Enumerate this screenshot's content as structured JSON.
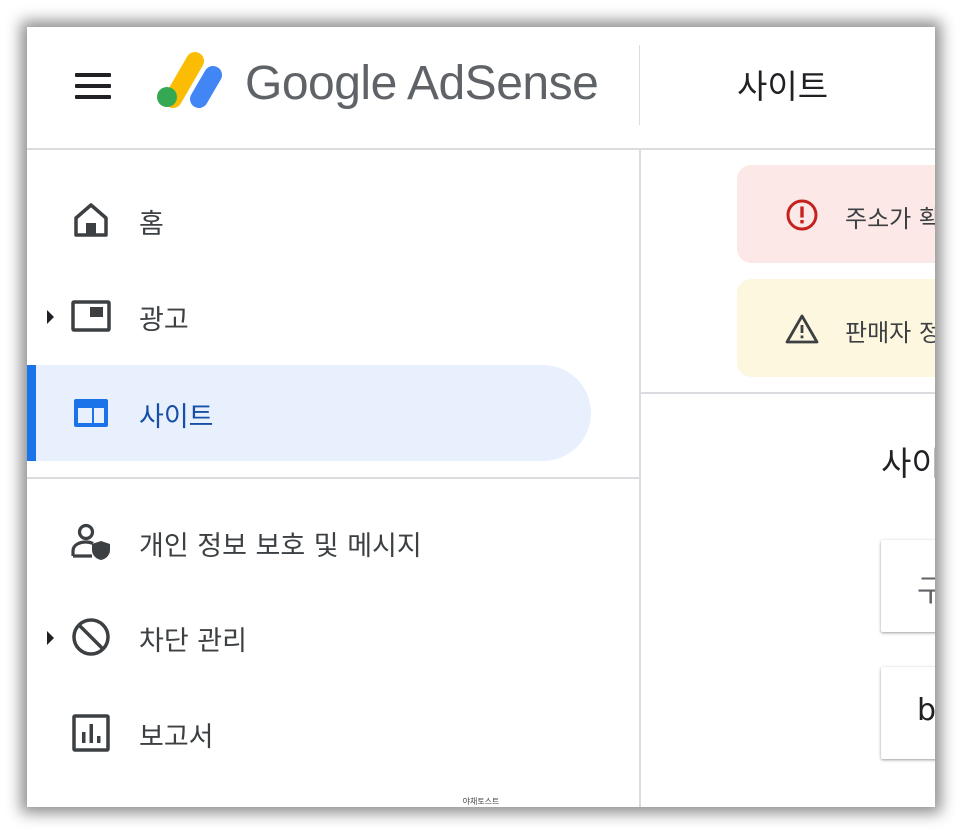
{
  "header": {
    "brand_text": "Google AdSense",
    "page_title": "사이트"
  },
  "sidebar": {
    "items": [
      {
        "label": "홈",
        "icon": "home-icon"
      },
      {
        "label": "광고",
        "icon": "ads-icon",
        "expandable": true
      },
      {
        "label": "사이트",
        "icon": "sites-icon",
        "active": true
      },
      {
        "label": "개인 정보 보호 및 메시지",
        "icon": "privacy-icon"
      },
      {
        "label": "차단 관리",
        "icon": "block-icon",
        "expandable": true
      },
      {
        "label": "보고서",
        "icon": "reports-icon"
      }
    ]
  },
  "main": {
    "alerts": [
      {
        "type": "error",
        "text": "주소가 확",
        "icon": "error-icon"
      },
      {
        "type": "warning",
        "text": "판매자 정",
        "icon": "warning-icon"
      }
    ],
    "section_title": "사이",
    "cards": [
      {
        "text": "구"
      },
      {
        "text": "b"
      }
    ]
  },
  "colors": {
    "accent": "#1a73e8",
    "active_bg": "#e8f0fe",
    "error_bg": "#fce8e6",
    "warning_bg": "#fef7e0",
    "error_icon": "#c5221f"
  },
  "watermark": "야채토스트"
}
